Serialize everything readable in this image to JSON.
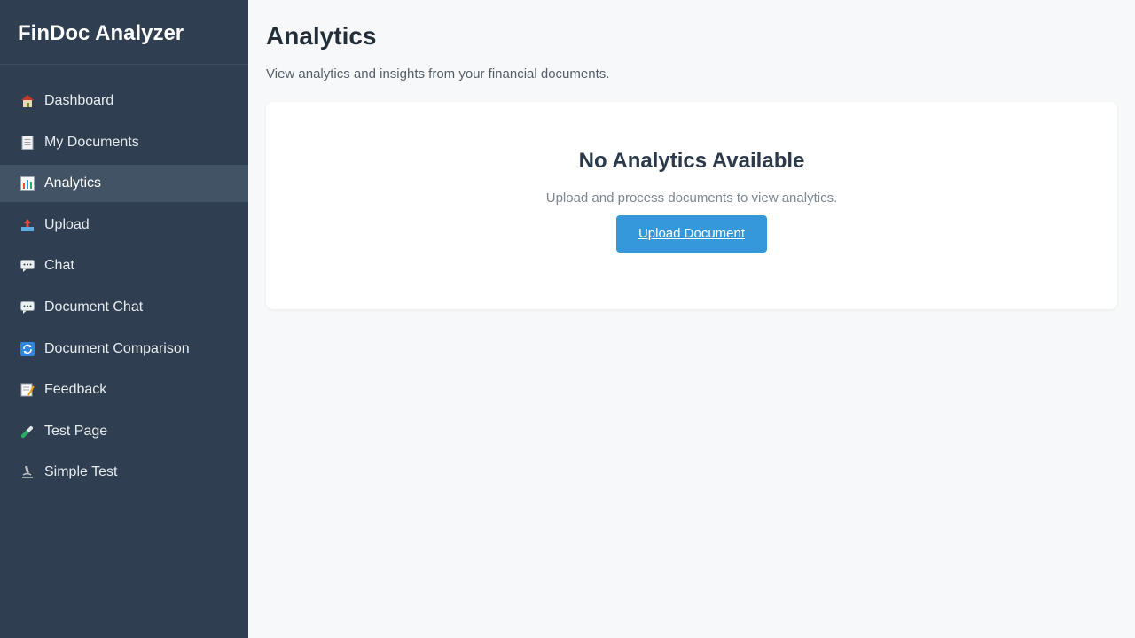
{
  "app": {
    "name": "FinDoc Analyzer"
  },
  "sidebar": {
    "items": [
      {
        "label": "Dashboard",
        "icon": "home-icon"
      },
      {
        "label": "My Documents",
        "icon": "document-icon"
      },
      {
        "label": "Analytics",
        "icon": "bar-chart-icon",
        "active": true
      },
      {
        "label": "Upload",
        "icon": "upload-tray-icon"
      },
      {
        "label": "Chat",
        "icon": "speech-bubble-icon"
      },
      {
        "label": "Document Chat",
        "icon": "speech-bubble-icon"
      },
      {
        "label": "Document Comparison",
        "icon": "refresh-icon"
      },
      {
        "label": "Feedback",
        "icon": "memo-icon"
      },
      {
        "label": "Test Page",
        "icon": "test-tube-icon"
      },
      {
        "label": "Simple Test",
        "icon": "microscope-icon"
      }
    ]
  },
  "main": {
    "title": "Analytics",
    "subtitle": "View analytics and insights from your financial documents.",
    "empty_state": {
      "title": "No Analytics Available",
      "text": "Upload and process documents to view analytics.",
      "button_label": "Upload Document"
    }
  },
  "colors": {
    "sidebar_bg": "#2f3e50",
    "sidebar_active": "#435366",
    "accent": "#3498db",
    "page_bg": "#f7f8fa"
  }
}
